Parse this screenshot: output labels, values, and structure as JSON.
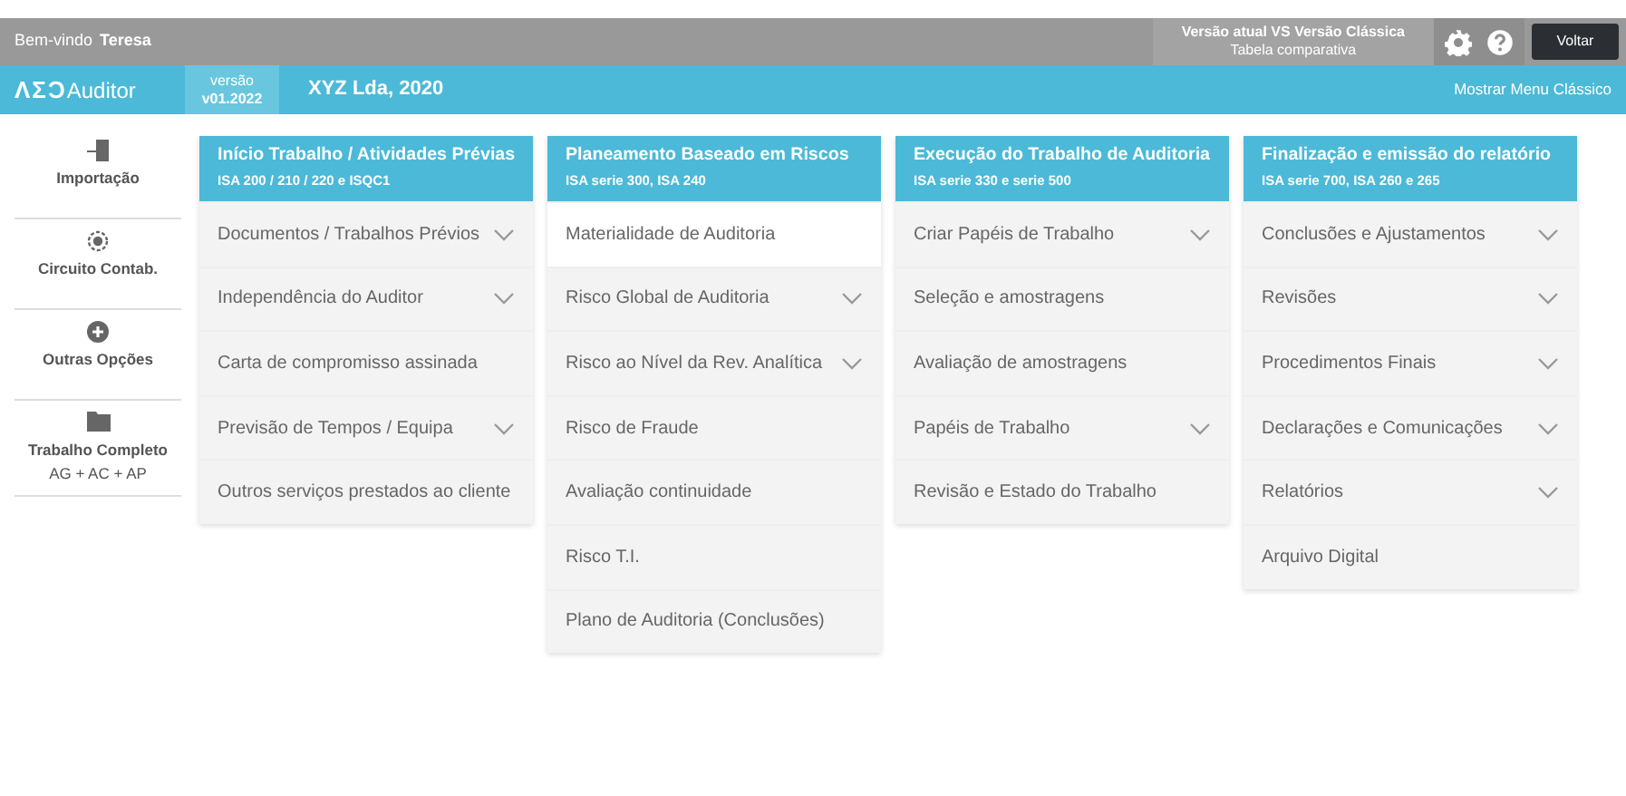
{
  "top_bar": {
    "greeting": "Bem-vindo",
    "user": "Teresa",
    "comparison_title": "Versão atual VS Versão Clássica",
    "comparison_subtitle": "Tabela comparativa",
    "back_button": "Voltar"
  },
  "app_bar": {
    "logo_mark": "ΛΣϽ",
    "logo_text": "Auditor",
    "version_label": "versão",
    "version": "v01.2022",
    "company": "XYZ Lda, 2020",
    "classic_menu_link": "Mostrar Menu Clássico"
  },
  "sidebar": {
    "items": [
      {
        "kind": "import",
        "label": "Importação"
      },
      {
        "kind": "circuit",
        "label": "Circuito Contab."
      },
      {
        "kind": "plus",
        "label": "Outras Opções"
      },
      {
        "kind": "folder",
        "label": "Trabalho Completo",
        "sublabel": "AG + AC + AP"
      }
    ]
  },
  "columns": [
    {
      "title": "Início Trabalho / Atividades Prévias",
      "subtitle": "ISA 200 / 210 / 220 e ISQC1",
      "items": [
        {
          "label": "Documentos / Trabalhos Prévios",
          "expandable": true,
          "selected": false
        },
        {
          "label": "Independência do Auditor",
          "expandable": true,
          "selected": false
        },
        {
          "label": "Carta de compromisso assinada",
          "expandable": false,
          "selected": false
        },
        {
          "label": "Previsão de Tempos / Equipa",
          "expandable": true,
          "selected": false
        },
        {
          "label": "Outros serviços prestados ao cliente",
          "expandable": false,
          "selected": false
        }
      ]
    },
    {
      "title": "Planeamento Baseado em Riscos",
      "subtitle": "ISA serie 300, ISA 240",
      "items": [
        {
          "label": "Materialidade de Auditoria",
          "expandable": false,
          "selected": true
        },
        {
          "label": "Risco Global de Auditoria",
          "expandable": true,
          "selected": false
        },
        {
          "label": "Risco ao Nível da Rev. Analítica",
          "expandable": true,
          "selected": false
        },
        {
          "label": "Risco de Fraude",
          "expandable": false,
          "selected": false
        },
        {
          "label": "Avaliação continuidade",
          "expandable": false,
          "selected": false
        },
        {
          "label": "Risco T.I.",
          "expandable": false,
          "selected": false
        },
        {
          "label": "Plano de Auditoria (Conclusões)",
          "expandable": false,
          "selected": false
        }
      ]
    },
    {
      "title": "Execução do Trabalho de Auditoria",
      "subtitle": "ISA serie 330 e serie 500",
      "items": [
        {
          "label": "Criar Papéis de Trabalho",
          "expandable": true,
          "selected": false
        },
        {
          "label": "Seleção e amostragens",
          "expandable": false,
          "selected": false
        },
        {
          "label": "Avaliação de amostragens",
          "expandable": false,
          "selected": false
        },
        {
          "label": "Papéis de Trabalho",
          "expandable": true,
          "selected": false
        },
        {
          "label": "Revisão e Estado do Trabalho",
          "expandable": false,
          "selected": false
        }
      ]
    },
    {
      "title": "Finalização e emissão do relatório",
      "subtitle": "ISA serie 700, ISA 260 e 265",
      "items": [
        {
          "label": "Conclusões e Ajustamentos",
          "expandable": true,
          "selected": false
        },
        {
          "label": "Revisões",
          "expandable": true,
          "selected": false
        },
        {
          "label": "Procedimentos Finais",
          "expandable": true,
          "selected": false
        },
        {
          "label": "Declarações e Comunicações",
          "expandable": true,
          "selected": false
        },
        {
          "label": "Relatórios",
          "expandable": true,
          "selected": false
        },
        {
          "label": "Arquivo Digital",
          "expandable": false,
          "selected": false
        }
      ]
    }
  ]
}
